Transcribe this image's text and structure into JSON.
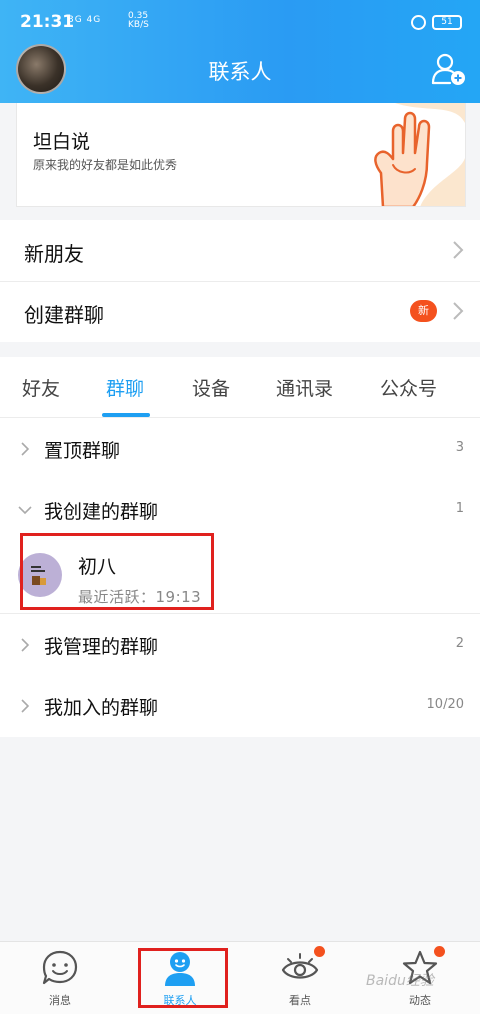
{
  "status_bar": {
    "time": "21:31",
    "network": "3G 4G",
    "speed": "0.35\nKB/S",
    "battery": "51"
  },
  "header": {
    "title": "联系人"
  },
  "banner": {
    "title": "坦白说",
    "subtitle": "原来我的好友都是如此优秀"
  },
  "menu": {
    "new_friends": "新朋友",
    "create_group": "创建群聊",
    "new_badge": "新"
  },
  "tabs": [
    {
      "label": "好友"
    },
    {
      "label": "群聊"
    },
    {
      "label": "设备"
    },
    {
      "label": "通讯录"
    },
    {
      "label": "公众号"
    }
  ],
  "active_tab": "群聊",
  "groups": {
    "pinned": {
      "label": "置顶群聊",
      "count": "3"
    },
    "created": {
      "label": "我创建的群聊",
      "count": "1"
    },
    "managed": {
      "label": "我管理的群聊",
      "count": "2"
    },
    "joined": {
      "label": "我加入的群聊",
      "count": "10/20"
    }
  },
  "group_item": {
    "name": "初八",
    "activity": "最近活跃：19:13"
  },
  "bottom_nav": [
    {
      "label": "消息",
      "icon": "smiley-chat-icon"
    },
    {
      "label": "联系人",
      "icon": "person-icon"
    },
    {
      "label": "看点",
      "icon": "eye-icon"
    },
    {
      "label": "动态",
      "icon": "star-icon"
    }
  ],
  "watermark": "Baidu经验",
  "colors": {
    "accent": "#1e9ff2",
    "header": "#2a9bf3",
    "badge": "#f4511e",
    "highlight": "#e0211e"
  }
}
